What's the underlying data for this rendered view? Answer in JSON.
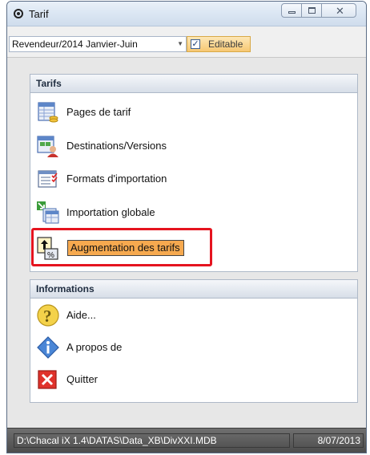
{
  "window": {
    "title": "Tarif",
    "controls": {
      "minimize_icon": "minimize-icon",
      "maximize_icon": "maximize-icon",
      "close_icon": "close-icon",
      "close_glyph": "✕"
    }
  },
  "toolbar": {
    "combo_value": "Revendeur/2014 Janvier-Juin",
    "editable_label": "Editable",
    "editable_checked": true
  },
  "groups": {
    "tarifs": {
      "header": "Tarifs",
      "items": [
        {
          "label": "Pages de tarif",
          "icon": "price-pages-icon"
        },
        {
          "label": "Destinations/Versions",
          "icon": "destinations-icon"
        },
        {
          "label": "Formats d'importation",
          "icon": "import-formats-icon"
        },
        {
          "label": "Importation globale",
          "icon": "global-import-icon"
        },
        {
          "label": "Augmentation des tarifs",
          "icon": "price-increase-icon"
        }
      ]
    },
    "informations": {
      "header": "Informations",
      "items": [
        {
          "label": "Aide...",
          "icon": "help-icon"
        },
        {
          "label": "A propos de",
          "icon": "info-icon"
        },
        {
          "label": "Quitter",
          "icon": "quit-icon"
        }
      ]
    }
  },
  "statusbar": {
    "path": "D:\\Chacal iX 1.4\\DATAS\\Data_XB\\DivXXI.MDB",
    "date": "8/07/2013"
  },
  "colors": {
    "highlight": "#f6a94f",
    "callout": "#e5141f"
  }
}
